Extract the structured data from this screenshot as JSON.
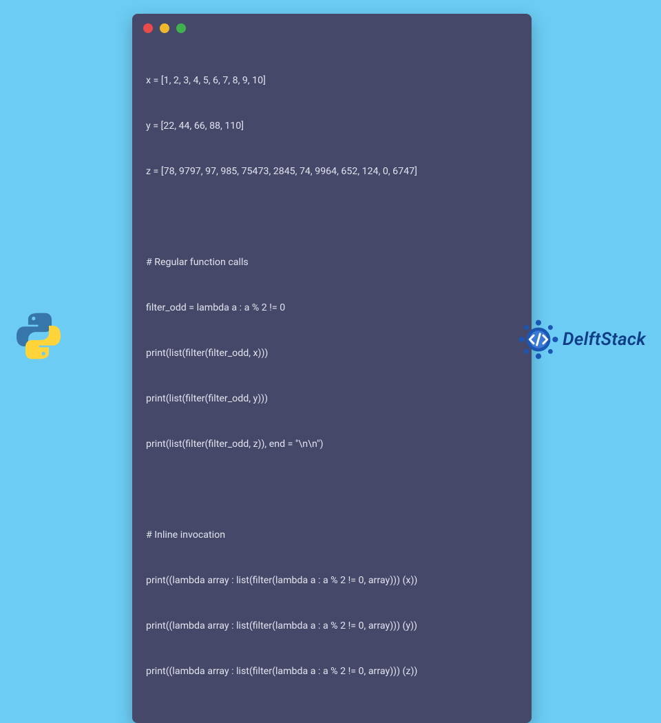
{
  "code": {
    "lines": [
      "x = [1, 2, 3, 4, 5, 6, 7, 8, 9, 10]",
      "y = [22, 44, 66, 88, 110]",
      "z = [78, 9797, 97, 985, 75473, 2845, 74, 9964, 652, 124, 0, 6747]",
      "",
      "# Regular function calls",
      "filter_odd = lambda a : a % 2 != 0",
      "print(list(filter(filter_odd, x)))",
      "print(list(filter(filter_odd, y)))",
      "print(list(filter(filter_odd, z)), end = \"\\n\\n\")",
      "",
      "# Inline invocation",
      "print((lambda array : list(filter(lambda a : a % 2 != 0, array))) (x))",
      "print((lambda array : list(filter(lambda a : a % 2 != 0, array))) (y))",
      "print((lambda array : list(filter(lambda a : a % 2 != 0, array))) (z))"
    ]
  },
  "brand": {
    "name": "DelftStack"
  },
  "colors": {
    "page_bg": "#6cccf4",
    "window_bg": "#454869",
    "code_fg": "#e3e4ee",
    "dot_red": "#e94b4b",
    "dot_yellow": "#f1b82d",
    "dot_green": "#3fb24f",
    "brand_blue": "#0f3d86"
  }
}
